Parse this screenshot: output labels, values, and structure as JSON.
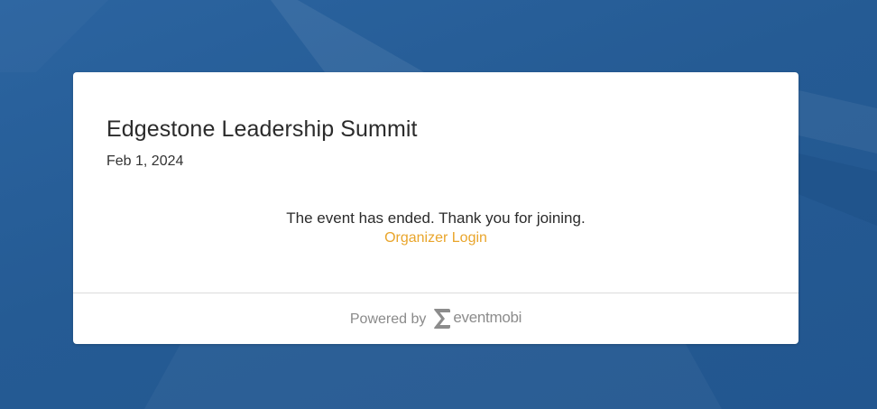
{
  "event": {
    "title": "Edgestone Leadership Summit",
    "date": "Feb 1, 2024"
  },
  "status": {
    "message": "The event has ended. Thank you for joining.",
    "login_link": "Organizer Login"
  },
  "footer": {
    "powered_by": "Powered by",
    "brand": "eventmobi",
    "brand_icon": "eventmobi-logo-icon"
  },
  "colors": {
    "background": "#255a92",
    "card": "#ffffff",
    "link": "#e9a52b",
    "muted": "#8a8a8a"
  }
}
